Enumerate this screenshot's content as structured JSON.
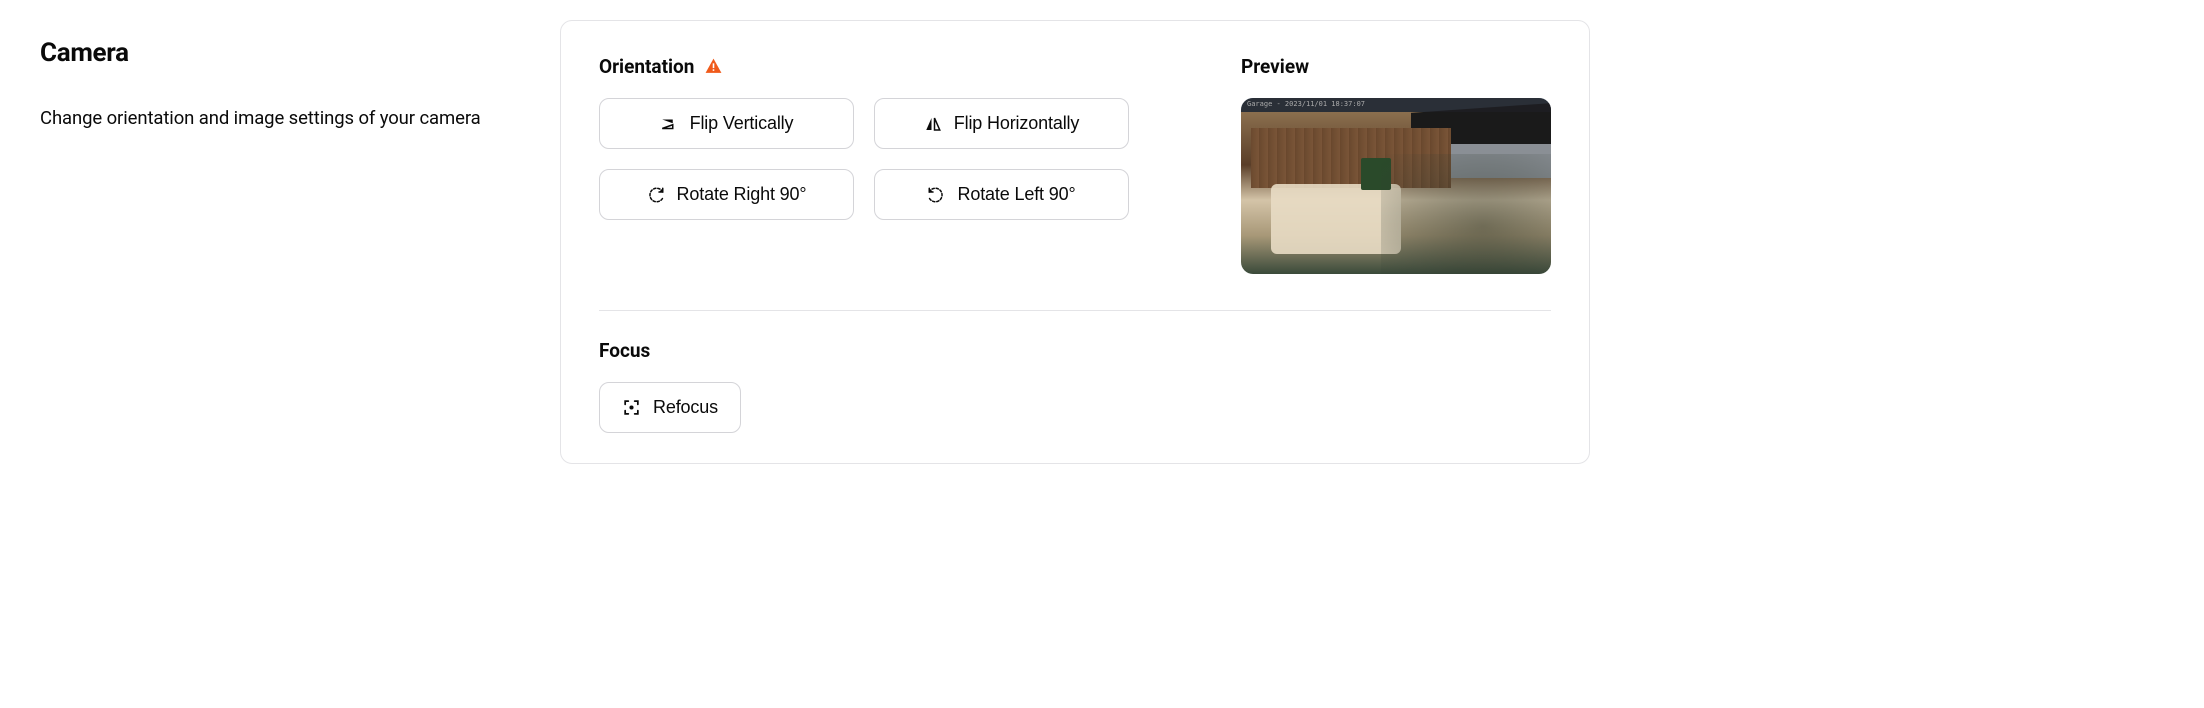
{
  "section": {
    "title": "Camera",
    "description": "Change orientation and image settings of your camera"
  },
  "orientation": {
    "heading": "Orientation",
    "buttons": {
      "flip_vertical": "Flip Vertically",
      "flip_horizontal": "Flip Horizontally",
      "rotate_right": "Rotate Right 90°",
      "rotate_left": "Rotate Left 90°"
    }
  },
  "preview": {
    "heading": "Preview",
    "overlay_text": "Garage - 2023/11/01 18:37:07"
  },
  "focus": {
    "heading": "Focus",
    "refocus_label": "Refocus"
  }
}
